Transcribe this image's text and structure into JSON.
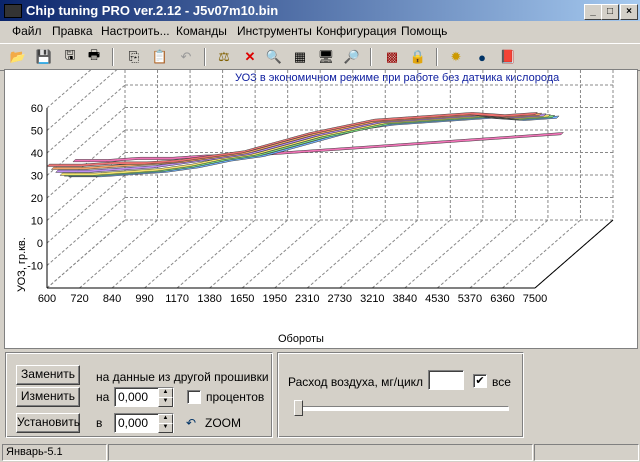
{
  "window": {
    "title": "Chip tuning PRO ver.2.12  -  J5v07m10.bin",
    "minimize": "_",
    "maximize": "□",
    "close": "×"
  },
  "menu": [
    "Файл",
    "Правка",
    "Настроить...",
    "Команды",
    "Инструменты",
    "Конфигурация",
    "Помощь"
  ],
  "toolbar_icons": [
    "open-icon",
    "save-icon",
    "save-as-icon",
    "print-icon",
    "copy-icon",
    "paste-icon",
    "undo-icon",
    "compare-icon",
    "delete-icon",
    "zoom-icon",
    "table-icon",
    "info-icon",
    "find-icon",
    "chip-icon",
    "lock-icon",
    "settings-icon",
    "globe-icon",
    "book-icon"
  ],
  "chart_data": {
    "type": "line",
    "title": "УОЗ в экономичном режиме при работе без датчика кислорода",
    "xlabel": "Обороты",
    "ylabel": "УОЗ, гр.кв.",
    "x": [
      "600",
      "720",
      "840",
      "990",
      "1170",
      "1380",
      "1650",
      "1950",
      "2310",
      "2730",
      "3210",
      "3840",
      "4530",
      "5370",
      "6360",
      "7500"
    ],
    "y_ticks": [
      60,
      50,
      40,
      30,
      20,
      10,
      0,
      -10
    ],
    "ylim": [
      -20,
      60
    ],
    "projection": "3d",
    "series": [
      {
        "values": [
          26,
          26,
          27,
          27,
          28,
          28,
          29,
          30,
          31,
          32,
          33,
          34,
          35,
          36,
          37,
          38
        ],
        "color": "#f06cb4"
      },
      {
        "values": [
          21,
          21,
          22,
          23,
          25,
          28,
          30,
          34,
          38,
          42,
          44,
          45,
          46,
          47,
          46,
          47
        ],
        "color": "#6ab0ff"
      },
      {
        "values": [
          23,
          23,
          24,
          25,
          27,
          30,
          32,
          36,
          40,
          43,
          46,
          47,
          48,
          49,
          48,
          49
        ],
        "color": "#7be07b"
      },
      {
        "values": [
          25,
          25,
          26,
          27,
          29,
          32,
          34,
          38,
          42,
          45,
          48,
          49,
          50,
          51,
          50,
          51
        ],
        "color": "#f7e66a"
      },
      {
        "values": [
          28,
          28,
          29,
          30,
          32,
          34,
          36,
          40,
          44,
          47,
          50,
          51,
          52,
          53,
          52,
          53
        ],
        "color": "#b98af0"
      },
      {
        "values": [
          31,
          31,
          32,
          33,
          34,
          36,
          38,
          42,
          46,
          49,
          52,
          53,
          54,
          55,
          54,
          55
        ],
        "color": "#f4a060"
      },
      {
        "values": [
          34,
          34,
          35,
          35,
          36,
          38,
          40,
          44,
          48,
          51,
          54,
          55,
          56,
          57,
          56,
          57
        ],
        "color": "#ee6e6e"
      }
    ],
    "grid": true
  },
  "controls": {
    "replace_button": "Заменить",
    "change_button": "Изменить",
    "set_button": "Установить",
    "from_other_label": "на данные из другой прошивки",
    "by_label": "на",
    "to_label": "в",
    "by_value": "0,000",
    "to_value": "0,000",
    "percent_label": "процентов",
    "zoom_label": "ZOOM",
    "airflow_label": "Расход воздуха, мг/цикл",
    "airflow_value": "",
    "all_label": "все",
    "all_checked": "✔",
    "percent_checked": "",
    "slider_position": 0
  },
  "status": {
    "panel1": "Январь-5.1",
    "panel2": "",
    "panel3": ""
  }
}
